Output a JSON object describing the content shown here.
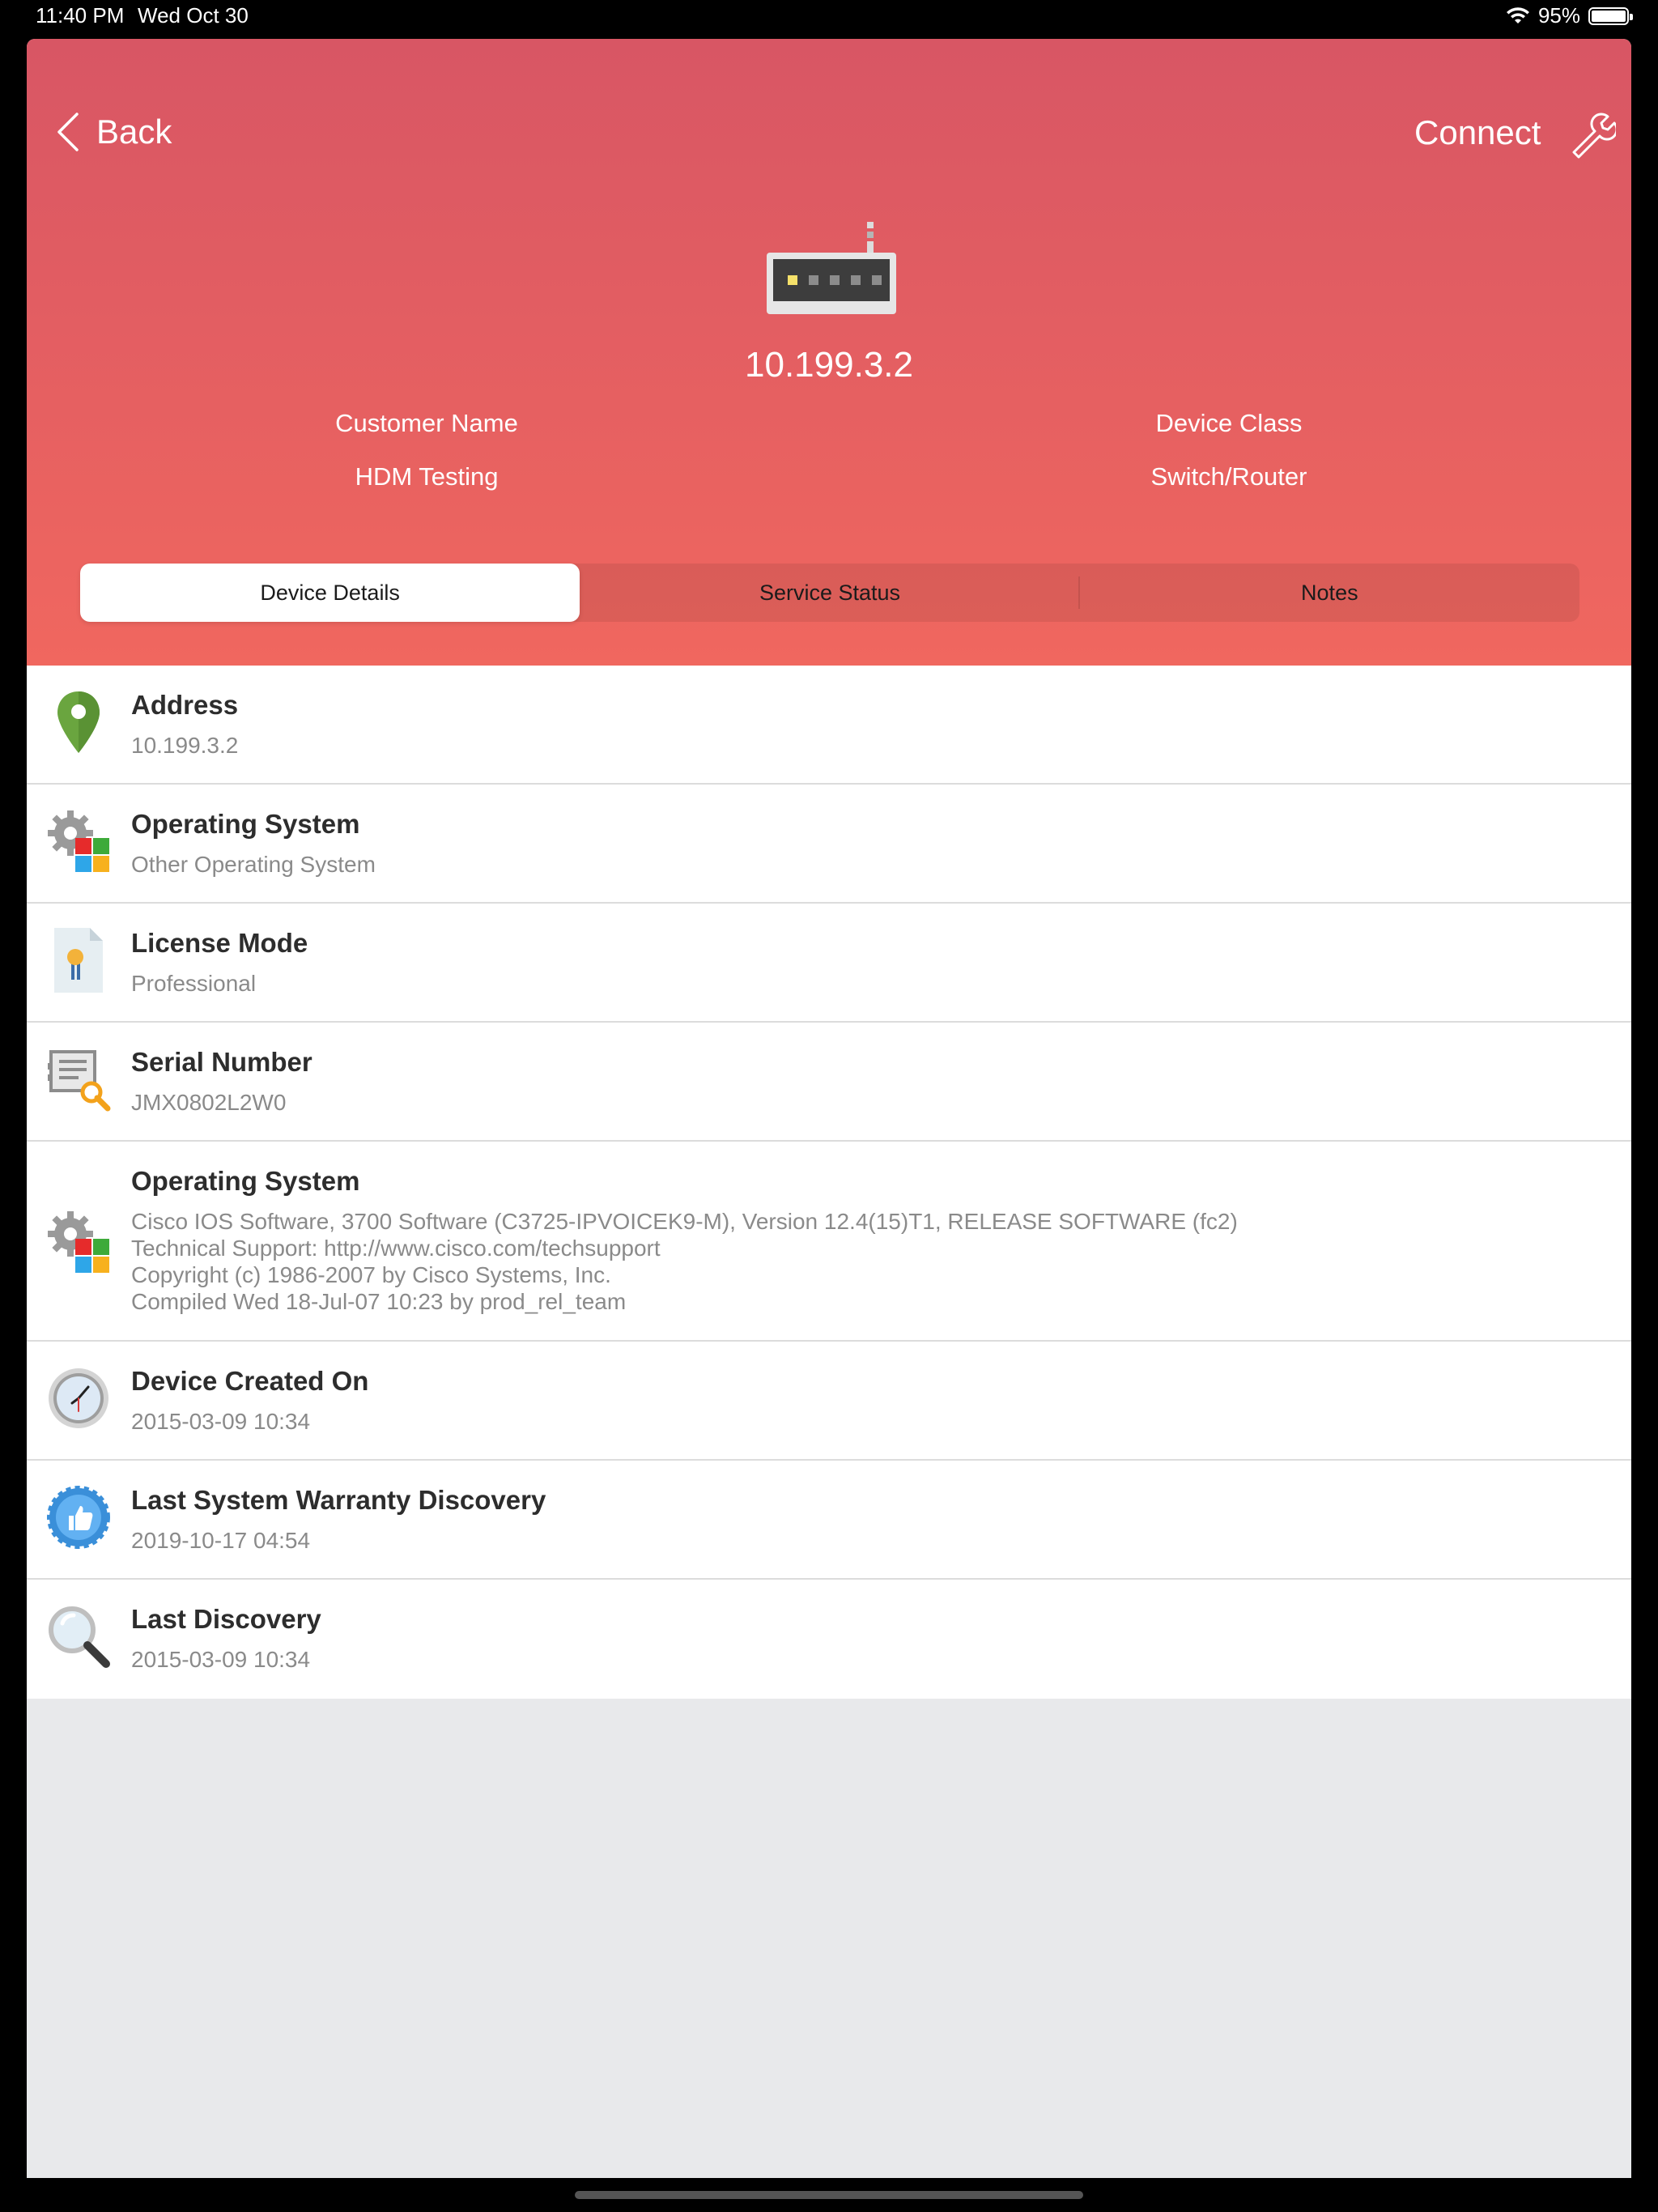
{
  "status_bar": {
    "time": "11:40 PM",
    "date": "Wed Oct 30",
    "battery": "95%"
  },
  "nav": {
    "back_label": "Back",
    "connect_label": "Connect"
  },
  "device": {
    "ip": "10.199.3.2",
    "customer_name_label": "Customer Name",
    "customer_name": "HDM Testing",
    "device_class_label": "Device Class",
    "device_class": "Switch/Router"
  },
  "tabs": [
    {
      "label": "Device Details",
      "active": true
    },
    {
      "label": "Service Status",
      "active": false
    },
    {
      "label": "Notes",
      "active": false
    }
  ],
  "details": [
    {
      "icon": "location-pin-icon",
      "title": "Address",
      "value": "10.199.3.2"
    },
    {
      "icon": "os-gear-icon",
      "title": "Operating System",
      "value": "Other Operating System"
    },
    {
      "icon": "license-certificate-icon",
      "title": "License Mode",
      "value": "Professional"
    },
    {
      "icon": "serial-search-icon",
      "title": "Serial Number",
      "value": "JMX0802L2W0"
    },
    {
      "icon": "os-gear-icon",
      "title": "Operating System",
      "value_lines": [
        "Cisco IOS Software, 3700 Software (C3725-IPVOICEK9-M), Version 12.4(15)T1, RELEASE SOFTWARE (fc2)",
        "Technical Support: http://www.cisco.com/techsupport",
        "Copyright (c) 1986-2007 by Cisco Systems, Inc.",
        "Compiled Wed 18-Jul-07 10:23 by prod_rel_team"
      ]
    },
    {
      "icon": "clock-icon",
      "title": "Device Created On",
      "value": "2015-03-09 10:34"
    },
    {
      "icon": "warranty-badge-icon",
      "title": "Last System Warranty Discovery",
      "value": "2019-10-17 04:54"
    },
    {
      "icon": "magnifier-icon",
      "title": "Last Discovery",
      "value": "2015-03-09 10:34"
    }
  ]
}
